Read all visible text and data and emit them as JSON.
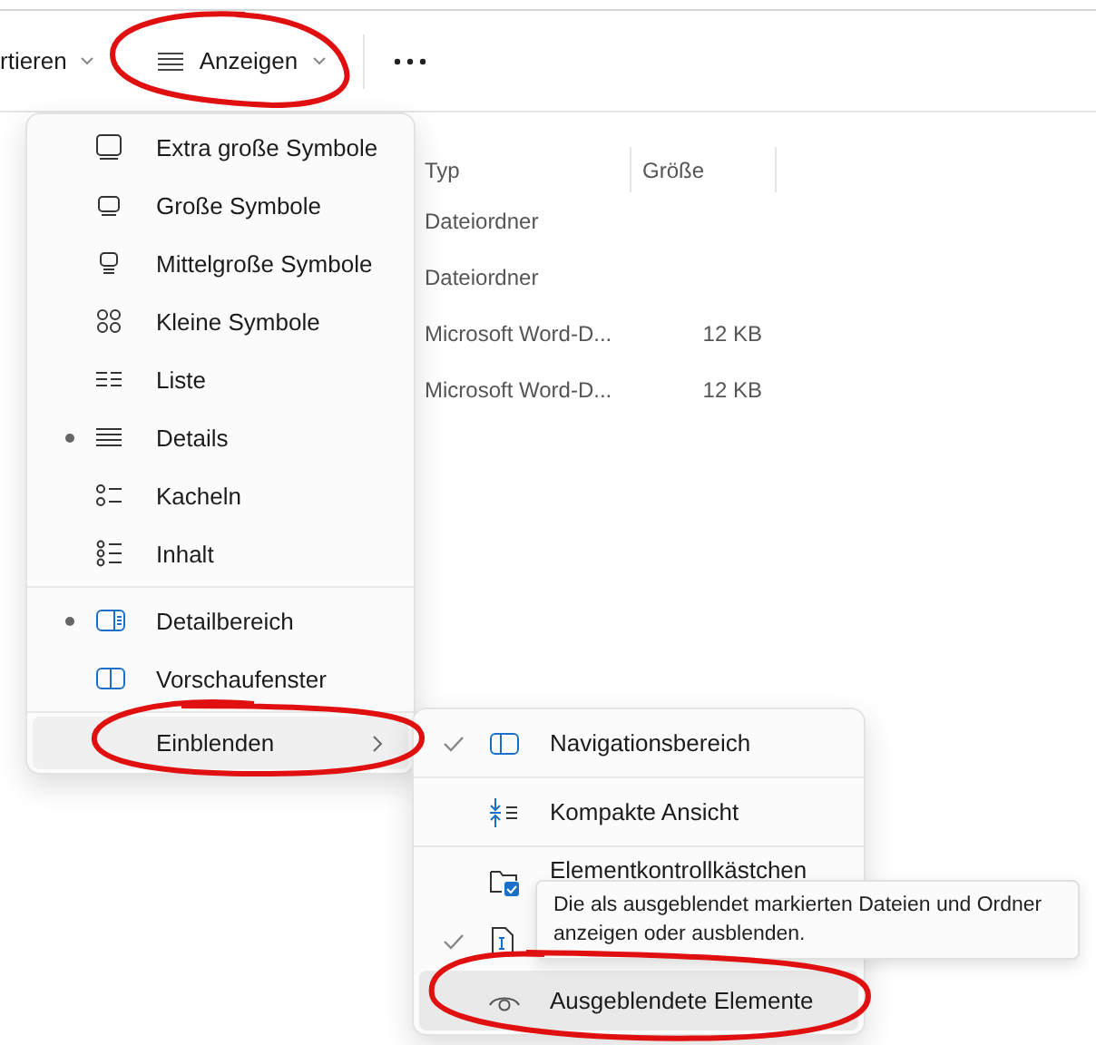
{
  "toolbar": {
    "sort_label": "rtieren",
    "view_button": "Anzeigen"
  },
  "file_list": {
    "columns": [
      "Typ",
      "Größe"
    ],
    "rows": [
      {
        "type": "Dateiordner",
        "size": ""
      },
      {
        "type": "Dateiordner",
        "size": ""
      },
      {
        "type": "Microsoft Word-D...",
        "size": "12 KB"
      },
      {
        "type": "Microsoft Word-D...",
        "size": "12 KB"
      }
    ]
  },
  "view_menu": {
    "items": [
      {
        "kind": "radio",
        "label": "Extra große Symbole",
        "selected": false,
        "highlighted": false
      },
      {
        "kind": "radio",
        "label": "Große Symbole",
        "selected": false,
        "highlighted": false
      },
      {
        "kind": "radio",
        "label": "Mittelgroße Symbole",
        "selected": false,
        "highlighted": false
      },
      {
        "kind": "radio",
        "label": "Kleine Symbole",
        "selected": false,
        "highlighted": false
      },
      {
        "kind": "radio",
        "label": "Liste",
        "selected": false,
        "highlighted": false
      },
      {
        "kind": "radio",
        "label": "Details",
        "selected": true,
        "highlighted": false
      },
      {
        "kind": "radio",
        "label": "Kacheln",
        "selected": false,
        "highlighted": false
      },
      {
        "kind": "radio",
        "label": "Inhalt",
        "selected": false,
        "highlighted": false
      },
      {
        "kind": "separator"
      },
      {
        "kind": "radio",
        "label": "Detailbereich",
        "selected": true,
        "highlighted": false
      },
      {
        "kind": "radio",
        "label": "Vorschaufenster",
        "selected": false,
        "highlighted": false
      },
      {
        "kind": "separator"
      },
      {
        "kind": "submenu",
        "label": "Einblenden",
        "highlighted": true
      }
    ]
  },
  "show_submenu": {
    "items": [
      {
        "kind": "check",
        "label": "Navigationsbereich",
        "checked": true,
        "highlighted": false
      },
      {
        "kind": "separator"
      },
      {
        "kind": "check",
        "label": "Kompakte Ansicht",
        "checked": false,
        "highlighted": false
      },
      {
        "kind": "separator"
      },
      {
        "kind": "check",
        "label": "Elementkontrollkästchen",
        "checked": false,
        "highlighted": false
      },
      {
        "kind": "check",
        "checked": true,
        "highlighted": false
      },
      {
        "kind": "check",
        "label": "Ausgeblendete Elemente",
        "checked": false,
        "highlighted": true
      }
    ]
  },
  "tooltip": {
    "text": "Die als ausgeblendet markierten Dateien und Ordner anzeigen oder ausblenden."
  }
}
